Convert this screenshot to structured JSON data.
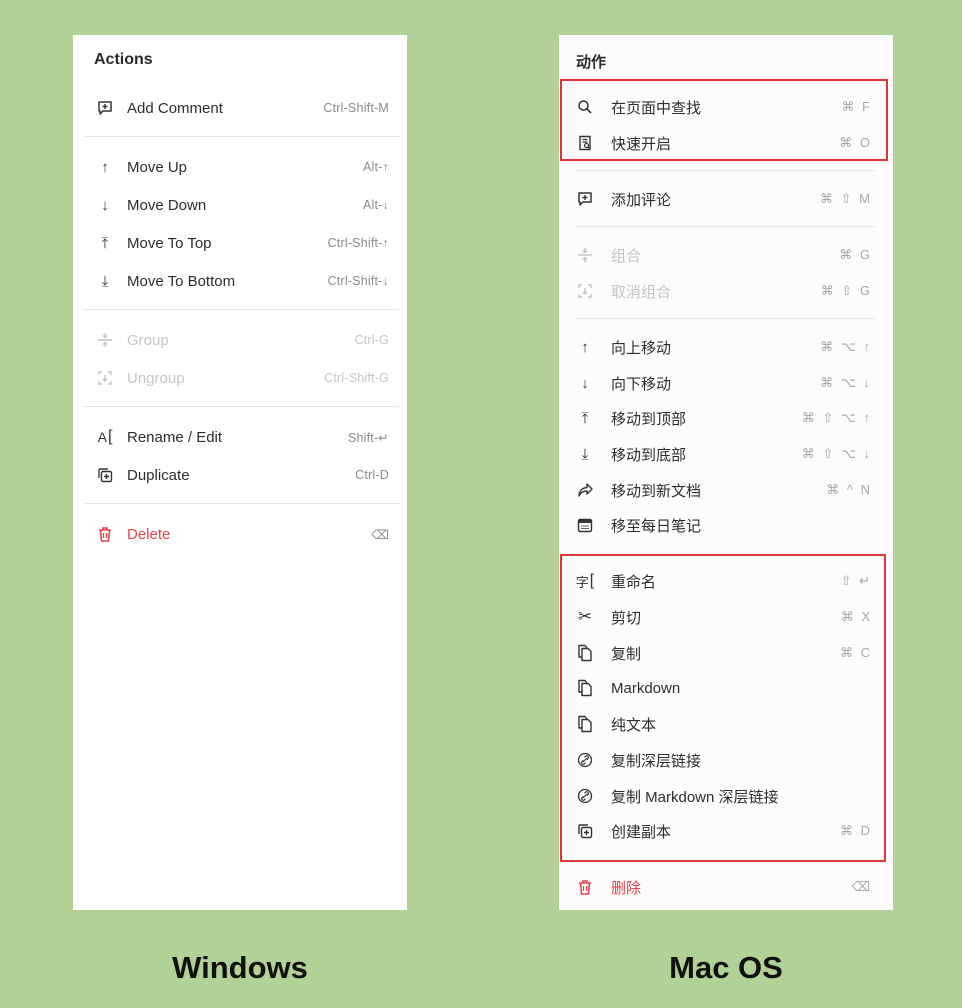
{
  "windows": {
    "heading": "Actions",
    "items": [
      {
        "label": "Add Comment",
        "shortcut": "Ctrl-Shift-M",
        "icon": "add-comment-icon"
      },
      {
        "label": "Move Up",
        "shortcut": "Alt-↑",
        "icon": "arrow-up-icon"
      },
      {
        "label": "Move Down",
        "shortcut": "Alt-↓",
        "icon": "arrow-down-icon"
      },
      {
        "label": "Move To Top",
        "shortcut": "Ctrl-Shift-↑",
        "icon": "arrow-to-top-icon"
      },
      {
        "label": "Move To Bottom",
        "shortcut": "Ctrl-Shift-↓",
        "icon": "arrow-to-bottom-icon"
      },
      {
        "label": "Group",
        "shortcut": "Ctrl-G",
        "icon": "group-icon",
        "disabled": true
      },
      {
        "label": "Ungroup",
        "shortcut": "Ctrl-Shift-G",
        "icon": "ungroup-icon",
        "disabled": true
      },
      {
        "label": "Rename / Edit",
        "shortcut": "Shift-↵",
        "icon": "rename-icon"
      },
      {
        "label": "Duplicate",
        "shortcut": "Ctrl-D",
        "icon": "duplicate-icon"
      },
      {
        "label": "Delete",
        "shortcut": "⌫",
        "icon": "trash-icon",
        "danger": true
      }
    ],
    "caption": "Windows"
  },
  "mac": {
    "heading": "动作",
    "items": [
      {
        "label": "在页面中查找",
        "shortcut": "⌘ F",
        "icon": "search-icon"
      },
      {
        "label": "快速开启",
        "shortcut": "⌘ O",
        "icon": "quick-open-icon"
      },
      {
        "label": "添加评论",
        "shortcut": "⌘ ⇧ M",
        "icon": "add-comment-icon"
      },
      {
        "label": "组合",
        "shortcut": "⌘ G",
        "icon": "group-icon",
        "disabled": true
      },
      {
        "label": "取消组合",
        "shortcut": "⌘ ⇧ G",
        "icon": "ungroup-icon",
        "disabled": true
      },
      {
        "label": "向上移动",
        "shortcut": "⌘ ⌥ ↑",
        "icon": "arrow-up-icon"
      },
      {
        "label": "向下移动",
        "shortcut": "⌘ ⌥ ↓",
        "icon": "arrow-down-icon"
      },
      {
        "label": "移动到顶部",
        "shortcut": "⌘ ⇧ ⌥ ↑",
        "icon": "arrow-to-top-icon"
      },
      {
        "label": "移动到底部",
        "shortcut": "⌘ ⇧ ⌥ ↓",
        "icon": "arrow-to-bottom-icon"
      },
      {
        "label": "移动到新文档",
        "shortcut": "⌘ ^ N",
        "icon": "share-arrow-icon"
      },
      {
        "label": "移至每日笔记",
        "shortcut": "",
        "icon": "calendar-icon"
      },
      {
        "label": "重命名",
        "shortcut": "⇧ ↵",
        "icon": "rename-icon"
      },
      {
        "label": "剪切",
        "shortcut": "⌘ X",
        "icon": "scissors-icon"
      },
      {
        "label": "复制",
        "shortcut": "⌘ C",
        "icon": "copy-icon"
      },
      {
        "label": "Markdown",
        "shortcut": "",
        "icon": "copy-icon"
      },
      {
        "label": "纯文本",
        "shortcut": "",
        "icon": "copy-icon"
      },
      {
        "label": "复制深层链接",
        "shortcut": "",
        "icon": "link-icon"
      },
      {
        "label": "复制 Markdown 深层链接",
        "shortcut": "",
        "icon": "link-icon"
      },
      {
        "label": "创建副本",
        "shortcut": "⌘ D",
        "icon": "duplicate-icon"
      },
      {
        "label": "删除",
        "shortcut": "⌫",
        "icon": "trash-icon",
        "danger": true
      }
    ],
    "caption": "Mac OS"
  },
  "colors": {
    "background": "#b2d197",
    "highlight": "#d9353a",
    "danger": "#e0424b"
  }
}
